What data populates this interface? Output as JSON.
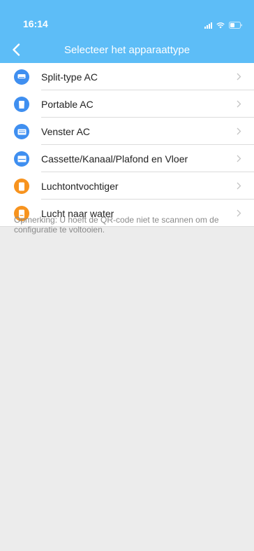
{
  "status_bar": {
    "time": "16:14"
  },
  "nav": {
    "title": "Selecteer het apparaattype",
    "back_icon": "chevron-left-icon"
  },
  "colors": {
    "header": "#5dbdf7",
    "blue_icon": "#3f8ff0",
    "orange_icon": "#f7931e",
    "background": "#ececec",
    "note_text": "#8a8a8a"
  },
  "devices": [
    {
      "label": "Split-type AC",
      "icon": "split-ac-icon",
      "color": "#3f8ff0"
    },
    {
      "label": "Portable AC",
      "icon": "portable-ac-icon",
      "color": "#3f8ff0"
    },
    {
      "label": "Venster AC",
      "icon": "window-ac-icon",
      "color": "#3f8ff0"
    },
    {
      "label": "Cassette/Kanaal/Plafond en Vloer",
      "icon": "cassette-ac-icon",
      "color": "#3f8ff0"
    },
    {
      "label": "Luchtontvochtiger",
      "icon": "dehumidifier-icon",
      "color": "#f7931e"
    },
    {
      "label": "Lucht naar water",
      "icon": "air-to-water-icon",
      "color": "#f7931e"
    }
  ],
  "note": "Opmerking: U hoeft de QR-code niet te scannen om de configuratie te voltooien."
}
